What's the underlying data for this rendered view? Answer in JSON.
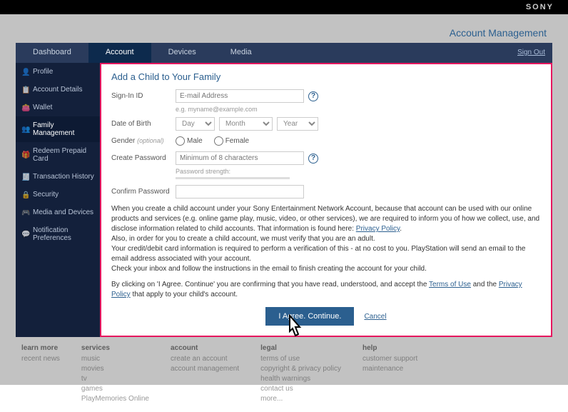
{
  "brand": "SONY",
  "header": {
    "title": "Account Management",
    "signout": "Sign Out"
  },
  "tabs": [
    {
      "label": "Dashboard"
    },
    {
      "label": "Account"
    },
    {
      "label": "Devices"
    },
    {
      "label": "Media"
    }
  ],
  "sidebar": {
    "items": [
      {
        "label": "Profile"
      },
      {
        "label": "Account Details"
      },
      {
        "label": "Wallet"
      },
      {
        "label": "Family Management"
      },
      {
        "label": "Redeem Prepaid Card"
      },
      {
        "label": "Transaction History"
      },
      {
        "label": "Security"
      },
      {
        "label": "Media and Devices"
      },
      {
        "label": "Notification Preferences"
      }
    ]
  },
  "form": {
    "title": "Add a Child to Your Family",
    "signin": {
      "label": "Sign-In ID",
      "placeholder": "E-mail Address",
      "hint": "e.g. myname@example.com"
    },
    "dob": {
      "label": "Date of Birth",
      "day": "Day",
      "month": "Month",
      "year": "Year"
    },
    "gender": {
      "label": "Gender",
      "optional": "(optional)",
      "male": "Male",
      "female": "Female"
    },
    "create_pw": {
      "label": "Create Password",
      "placeholder": "Minimum of 8 characters",
      "strength": "Password strength:"
    },
    "confirm_pw": {
      "label": "Confirm Password"
    },
    "info1": "When you create a child account under your Sony Entertainment Network Account, because that account can be used with our online products and services (e.g. online game play, music, video, or other services), we are required to inform you of how we collect, use, and disclose information related to child accounts. That information is found here: ",
    "link_pp": "Privacy Policy",
    "dot": ".",
    "info2": "Also, in order for you to create a child account, we must verify that you are an adult.",
    "info3": "Your credit/debit card information is required to perform a verification of this - at no cost to you. PlayStation will send an email to the email address associated with your account.",
    "info4": "Check your inbox and follow the instructions in the email to finish creating the account for your child.",
    "info5a": "By clicking on 'I Agree. Continue' you are confirming that you have read, understood, and accept the ",
    "link_tou": "Terms of Use",
    "info5b": " and the ",
    "info5c": " that apply to your child's account.",
    "agree_btn": "I Agree. Continue.",
    "cancel": "Cancel"
  },
  "footer": {
    "cols": [
      {
        "h": "learn more",
        "items": [
          "recent news"
        ]
      },
      {
        "h": "services",
        "items": [
          "music",
          "movies",
          "tv",
          "games",
          "PlayMemories Online"
        ]
      },
      {
        "h": "account",
        "items": [
          "create an account",
          "account management"
        ]
      },
      {
        "h": "legal",
        "items": [
          "terms of use",
          "copyright & privacy policy",
          "health warnings",
          "contact us",
          "more..."
        ]
      },
      {
        "h": "help",
        "items": [
          "customer support",
          "maintenance"
        ]
      }
    ]
  }
}
